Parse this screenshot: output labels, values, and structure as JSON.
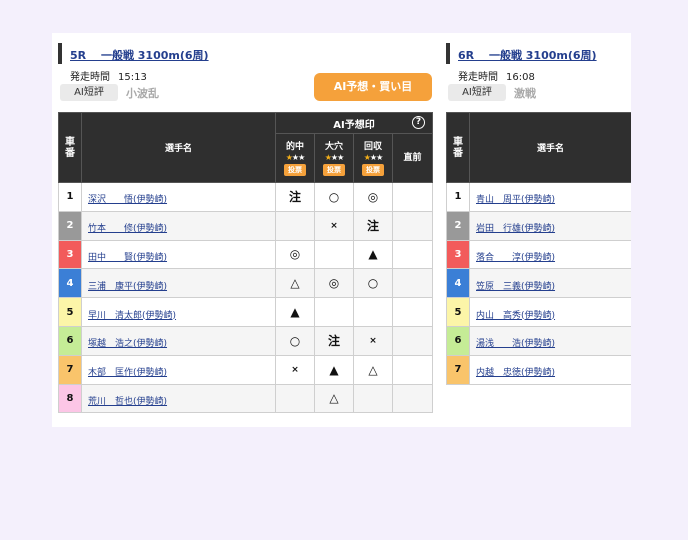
{
  "races": [
    {
      "title": "5R　 一般戦 3100m(6周)",
      "start_label": "発走時間",
      "start_time": "15:13",
      "ai_badge": "AI短評",
      "evaluation": "小波乱",
      "ai_button": "AI予想・買い目",
      "table": {
        "col_num": [
          "車",
          "番"
        ],
        "col_name": "選手名",
        "col_ai": "AI予想印",
        "help": "?",
        "sub_cols": [
          "的中",
          "大穴",
          "回収",
          "直前"
        ],
        "stars": "★★★",
        "vote_label": "投票",
        "rows": [
          {
            "num": "1",
            "name": "深沢　　悟(伊勢崎)",
            "color": "#ffffff",
            "text": "#111111",
            "marks": [
              "注",
              "○",
              "◎",
              ""
            ]
          },
          {
            "num": "2",
            "name": "竹本　　修(伊勢崎)",
            "color": "#999999",
            "text": "#ffffff",
            "marks": [
              "",
              "×",
              "注",
              ""
            ]
          },
          {
            "num": "3",
            "name": "田中　　賢(伊勢崎)",
            "color": "#f25b5b",
            "text": "#ffffff",
            "marks": [
              "◎",
              "",
              "▲",
              ""
            ]
          },
          {
            "num": "4",
            "name": "三浦　康平(伊勢崎)",
            "color": "#3b7fd6",
            "text": "#ffffff",
            "marks": [
              "△",
              "◎",
              "○",
              ""
            ]
          },
          {
            "num": "5",
            "name": "早川　清太郎(伊勢崎)",
            "color": "#fcf5a8",
            "text": "#111111",
            "marks": [
              "▲",
              "",
              "",
              ""
            ]
          },
          {
            "num": "6",
            "name": "塚越　浩之(伊勢崎)",
            "color": "#c5ec96",
            "text": "#111111",
            "marks": [
              "○",
              "注",
              "×",
              ""
            ]
          },
          {
            "num": "7",
            "name": "木部　匡作(伊勢崎)",
            "color": "#f9c46b",
            "text": "#111111",
            "marks": [
              "×",
              "▲",
              "△",
              ""
            ]
          },
          {
            "num": "8",
            "name": "荒川　哲也(伊勢崎)",
            "color": "#fcc6e6",
            "text": "#111111",
            "marks": [
              "",
              "△",
              "",
              ""
            ]
          }
        ]
      }
    },
    {
      "title": "6R　 一般戦 3100m(6周)",
      "start_label": "発走時間",
      "start_time": "16:08",
      "ai_badge": "AI短評",
      "evaluation": "激戦",
      "table": {
        "col_num": [
          "車",
          "番"
        ],
        "col_name": "選手名",
        "rows": [
          {
            "num": "1",
            "name": "青山　周平(伊勢崎)",
            "color": "#ffffff",
            "text": "#111111"
          },
          {
            "num": "2",
            "name": "岩田　行雄(伊勢崎)",
            "color": "#999999",
            "text": "#ffffff"
          },
          {
            "num": "3",
            "name": "落合　　淳(伊勢崎)",
            "color": "#f25b5b",
            "text": "#ffffff"
          },
          {
            "num": "4",
            "name": "笠原　三義(伊勢崎)",
            "color": "#3b7fd6",
            "text": "#ffffff"
          },
          {
            "num": "5",
            "name": "内山　高秀(伊勢崎)",
            "color": "#fcf5a8",
            "text": "#111111"
          },
          {
            "num": "6",
            "name": "湯浅　　浩(伊勢崎)",
            "color": "#c5ec96",
            "text": "#111111"
          },
          {
            "num": "7",
            "name": "内越　忠徳(伊勢崎)",
            "color": "#f9c46b",
            "text": "#111111"
          }
        ]
      }
    }
  ]
}
